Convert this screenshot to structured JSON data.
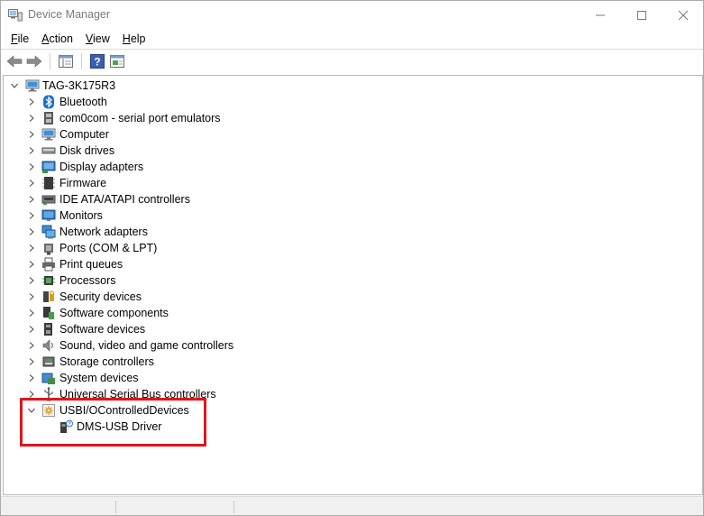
{
  "window": {
    "title": "Device Manager",
    "controls": {
      "minimize": "—",
      "maximize": "☐",
      "close": "✕"
    }
  },
  "menu": [
    {
      "label": "File",
      "mnemonic": "F"
    },
    {
      "label": "Action",
      "mnemonic": "A"
    },
    {
      "label": "View",
      "mnemonic": "V"
    },
    {
      "label": "Help",
      "mnemonic": "H"
    }
  ],
  "toolbar": {
    "buttons": [
      "back-arrow-icon",
      "forward-arrow-icon",
      "properties-icon",
      "help-icon",
      "update-driver-icon"
    ]
  },
  "tree": {
    "root": {
      "label": "TAG-3K175R3",
      "icon": "computer-icon",
      "expanded": true
    },
    "categories": [
      {
        "label": "Bluetooth",
        "icon": "bluetooth-icon"
      },
      {
        "label": "com0com - serial port emulators",
        "icon": "port-emulator-icon"
      },
      {
        "label": "Computer",
        "icon": "computer-icon"
      },
      {
        "label": "Disk drives",
        "icon": "disk-drive-icon"
      },
      {
        "label": "Display adapters",
        "icon": "display-adapter-icon"
      },
      {
        "label": "Firmware",
        "icon": "firmware-icon"
      },
      {
        "label": "IDE ATA/ATAPI controllers",
        "icon": "ide-controller-icon"
      },
      {
        "label": "Monitors",
        "icon": "monitor-icon"
      },
      {
        "label": "Network adapters",
        "icon": "network-adapter-icon"
      },
      {
        "label": "Ports (COM & LPT)",
        "icon": "port-icon"
      },
      {
        "label": "Print queues",
        "icon": "printer-icon"
      },
      {
        "label": "Processors",
        "icon": "processor-icon"
      },
      {
        "label": "Security devices",
        "icon": "security-device-icon"
      },
      {
        "label": "Software components",
        "icon": "software-component-icon"
      },
      {
        "label": "Software devices",
        "icon": "software-device-icon"
      },
      {
        "label": "Sound, video and game controllers",
        "icon": "speaker-icon"
      },
      {
        "label": "Storage controllers",
        "icon": "storage-controller-icon"
      },
      {
        "label": "System devices",
        "icon": "system-device-icon"
      },
      {
        "label": "Universal Serial Bus controllers",
        "icon": "usb-icon"
      }
    ],
    "expanded_category": {
      "label": "USBI/OControlledDevices",
      "icon": "usb-controlled-device-icon",
      "children": [
        {
          "label": "DMS-USB Driver",
          "icon": "unknown-device-icon"
        }
      ]
    }
  },
  "colors": {
    "highlight_border": "#e0151b",
    "title_text": "#7a7a7a",
    "status_bar": "#f0f0f0"
  }
}
